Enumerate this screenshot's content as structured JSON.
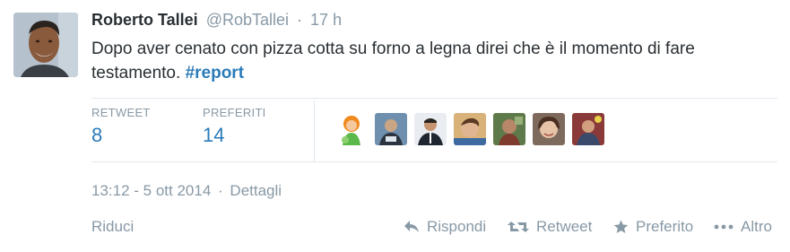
{
  "author": {
    "fullname": "Roberto Tallei",
    "username": "@RobTallei",
    "time": "17 h",
    "separator": "·"
  },
  "tweet": {
    "text": "Dopo aver cenato con pizza cotta su forno a legna direi che è il momento di fare testamento.",
    "hashtag": "#report"
  },
  "stats": {
    "retweet_label": "RETWEET",
    "retweet_count": "8",
    "favorites_label": "PREFERITI",
    "favorites_count": "14"
  },
  "meta": {
    "timestamp": "13:12 - 5 ott 2014",
    "separator": "·",
    "details_label": "Dettagli"
  },
  "actions": {
    "collapse_label": "Riduci",
    "reply_label": "Rispondi",
    "retweet_label": "Retweet",
    "favorite_label": "Preferito",
    "more_label": "Altro"
  },
  "colors": {
    "link": "#2b7bb9",
    "muted": "#8899a6",
    "text": "#292f33",
    "divider": "#e1e8ed"
  },
  "icons": {
    "reply": "reply-icon",
    "retweet": "retweet-icon",
    "favorite": "star-icon",
    "more": "more-dots-icon"
  }
}
